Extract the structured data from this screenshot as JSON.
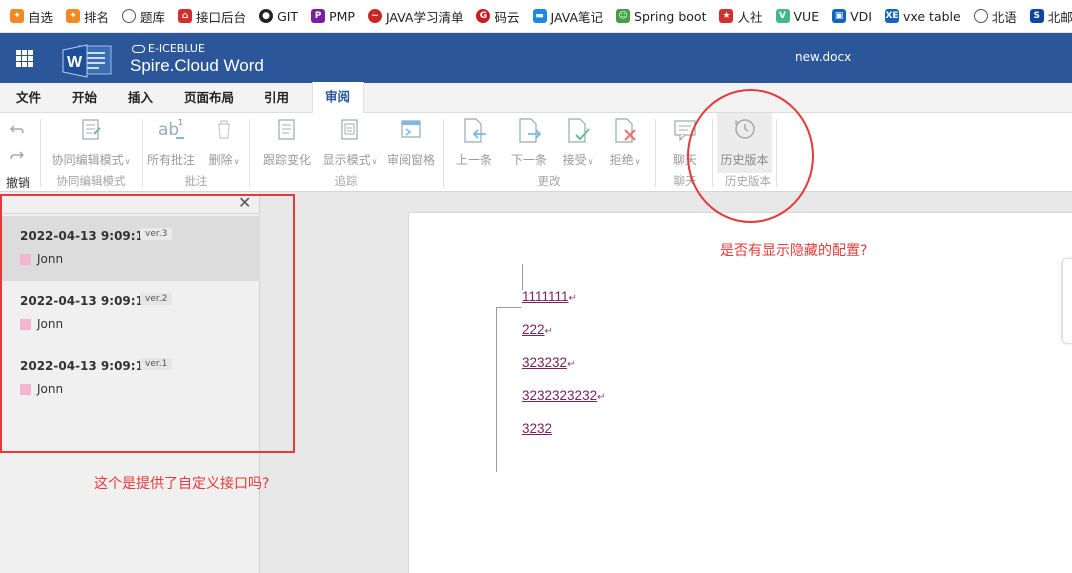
{
  "bookmarks": [
    {
      "label": "自选",
      "icon": "flame-icon",
      "color": "#f08a24"
    },
    {
      "label": "排名",
      "icon": "flame-icon",
      "color": "#f08a24"
    },
    {
      "label": "题库",
      "icon": "globe-icon",
      "color": "#555555"
    },
    {
      "label": "接口后台",
      "icon": "house-icon",
      "color": "#d32f2f"
    },
    {
      "label": "GIT",
      "icon": "github-icon",
      "color": "#222222"
    },
    {
      "label": "PMP",
      "icon": "pmp-icon",
      "color": "#7b1fa2"
    },
    {
      "label": "JAVA学习清单",
      "icon": "swirl-icon",
      "color": "#c62828"
    },
    {
      "label": "码云",
      "icon": "gitee-icon",
      "color": "#c71d23"
    },
    {
      "label": "JAVA笔记",
      "icon": "note-icon",
      "color": "#1e88e5"
    },
    {
      "label": "Spring boot",
      "icon": "avatar-icon",
      "color": "#43a047"
    },
    {
      "label": "人社",
      "icon": "emblem-icon",
      "color": "#d32f2f"
    },
    {
      "label": "VUE",
      "icon": "vue-icon",
      "color": "#42b883"
    },
    {
      "label": "VDI",
      "icon": "lock-icon",
      "color": "#1565c0"
    },
    {
      "label": "vxe table",
      "icon": "xe-icon",
      "color": "#1565c0"
    },
    {
      "label": "北语",
      "icon": "globe-icon",
      "color": "#555555"
    },
    {
      "label": "北邮",
      "icon": "satellite-icon",
      "color": "#0d47a1"
    }
  ],
  "app": {
    "vendor": "E-ICEBLUE",
    "product": "Spire.Cloud Word",
    "document_name": "new.docx"
  },
  "tabs": [
    "文件",
    "开始",
    "插入",
    "页面布局",
    "引用",
    "审阅"
  ],
  "active_tab": "审阅",
  "ribbon": {
    "undo_label": "撤销",
    "buttons": {
      "coedit": "协同编辑模式",
      "all_comments": "所有批注",
      "delete": "删除",
      "track_changes": "跟踪变化",
      "display_mode": "显示模式",
      "review_pane": "审阅窗格",
      "prev": "上一条",
      "next": "下一条",
      "accept": "接受",
      "reject": "拒绝",
      "chat": "聊天",
      "history": "历史版本"
    },
    "groups": {
      "coedit": "协同编辑模式",
      "comments": "批注",
      "track": "追踪",
      "changes": "更改",
      "chat": "聊天",
      "history": "历史版本"
    }
  },
  "versions": [
    {
      "time": "2022-04-13 9:09:13",
      "tag": "ver.3",
      "user": "Jonn"
    },
    {
      "time": "2022-04-13 9:09:13",
      "tag": "ver.2",
      "user": "Jonn"
    },
    {
      "time": "2022-04-13 9:09:13",
      "tag": "ver.1",
      "user": "Jonn"
    }
  ],
  "document_lines": [
    "1111111",
    "222",
    "323232",
    "3232323232",
    "3232"
  ],
  "annotations": {
    "hidden_config_question": "是否有显示隐藏的配置?",
    "custom_api_question": "这个是提供了自定义接口吗?"
  },
  "colors": {
    "header_blue": "#2b579a",
    "annotation_red": "#e5393a",
    "revision_text": "#7b2060",
    "author_swatch": "#f4b5cf"
  }
}
